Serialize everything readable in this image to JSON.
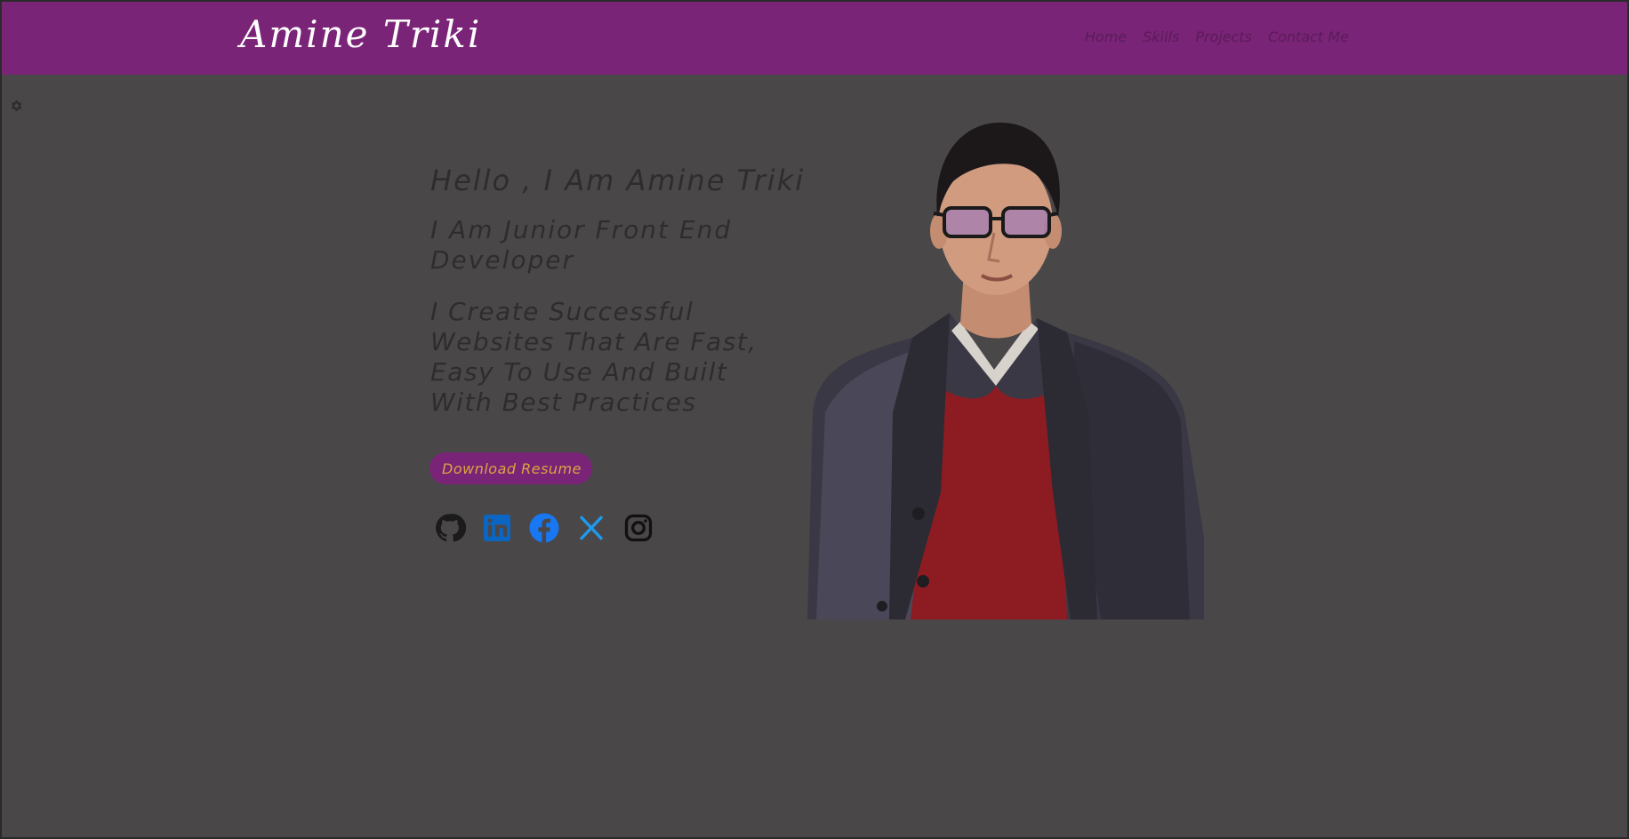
{
  "header": {
    "brand": "Amine Triki",
    "nav": [
      "Home",
      "Skills",
      "Projects",
      "Contact Me"
    ]
  },
  "hero": {
    "greeting": "Hello , I Am Amine Triki",
    "role": "I Am Junior Front End Developer",
    "description": "I Create Successful Websites That Are Fast, Easy To Use And Built With Best Practices",
    "button_label": "Download Resume"
  },
  "socials": [
    {
      "icon": "github-icon",
      "color": "#1b1b1b"
    },
    {
      "icon": "linkedin-icon",
      "color": "#0a66c2"
    },
    {
      "icon": "facebook-icon",
      "color": "#1877f2"
    },
    {
      "icon": "x-icon",
      "color": "#1d9bf0"
    },
    {
      "icon": "instagram-icon",
      "color": "#111111"
    }
  ],
  "colors": {
    "primary": "#7a2478",
    "background": "#4a4749",
    "accent_text": "#d9a441"
  }
}
